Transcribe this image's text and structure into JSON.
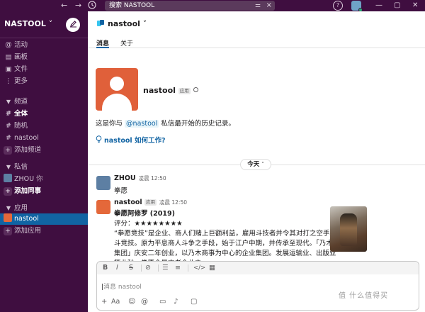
{
  "topbar": {
    "search_placeholder": "搜索 NASTOOL",
    "back_icon": "arrow-left-icon",
    "forward_icon": "arrow-right-icon",
    "history_icon": "clock-icon",
    "help_label": "?",
    "filter_icon": "sliders-icon",
    "clear_icon": "close-icon"
  },
  "sidebar": {
    "workspace_name": "NASTOOL",
    "workspace_caret": "˅",
    "items": [
      {
        "icon": "@",
        "label": "活动"
      },
      {
        "icon": "▤",
        "label": "画板"
      },
      {
        "icon": "▣",
        "label": "文件"
      },
      {
        "icon": "⋮",
        "label": "更多"
      }
    ],
    "channels_header": "频道",
    "channels": [
      {
        "label": "全体"
      },
      {
        "label": "随机"
      },
      {
        "label": "nastool"
      }
    ],
    "add_channel": "添加频道",
    "dm_header": "私信",
    "dms": [
      {
        "label": "ZHOU",
        "suffix": "你"
      }
    ],
    "add_colleague": "添加同事",
    "apps_header": "应用",
    "apps": [
      {
        "label": "nastool"
      }
    ],
    "add_app": "添加应用"
  },
  "channel": {
    "name": "nastool",
    "caret": "˅",
    "tabs": [
      "消息",
      "关于"
    ]
  },
  "intro": {
    "name": "nastool",
    "badge": "应用",
    "text_before": "这是你与",
    "mention": "@nastool",
    "text_after": "私信最开始的历史记录。",
    "how_link": "nastool 如何工作?"
  },
  "day_divider": "今天",
  "messages": [
    {
      "author": "ZHOU",
      "time": "凌晨 12:50",
      "text": "拳愿"
    },
    {
      "author": "nastool",
      "badge": "应用",
      "time": "凌晨 12:50",
      "title": "拳愿阿修罗 (2019)",
      "rating": "评分：★★★★★★★★",
      "lines": [
        "“拳愿竞技”是企业、商人们赌上巨额利益，雇用斗技者并令其对打之空手格",
        "斗竞技。原为平息商人斗争之手段，始于江户中期，并传承至现代。「乃木",
        "集团」庆安二年创业，以乃木商事为中心的企业集团。发展运输业、出版业",
        "等业种，拳愿会最古老企业之一。"
      ]
    }
  ],
  "composer": {
    "placeholder": "消息 nastool",
    "format_buttons": [
      "B",
      "I",
      "S",
      "🔗",
      "⋮≡",
      "≡",
      "</>",
      "⌘"
    ],
    "actions": [
      "+",
      "Aa",
      "☺",
      "@",
      "▭",
      "🎙",
      "▢"
    ]
  },
  "watermark": "值 什么值得买"
}
